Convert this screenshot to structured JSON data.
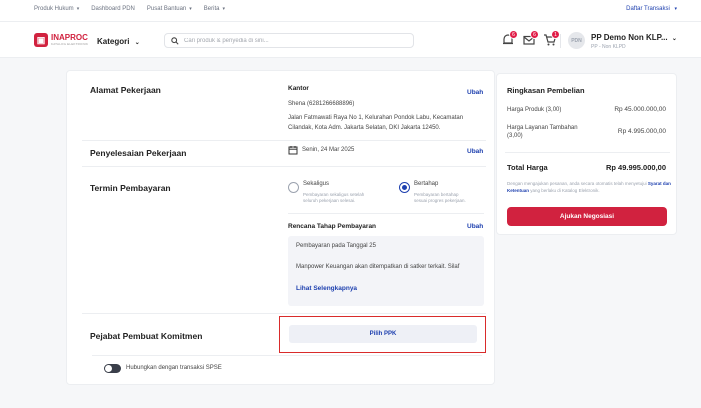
{
  "topnav": {
    "items": [
      "Produk Hukum",
      "Dashboard PDN",
      "Pusat Bantuan",
      "Berita"
    ],
    "daftar_transaksi": "Daftar Transaksi"
  },
  "header": {
    "logo_text": "INAPROC",
    "logo_sub": "KATALOG ELEKTRONIK",
    "kategori": "Kategori",
    "search_placeholder": "Cari produk & penyedia di sini...",
    "badges": [
      "6",
      "6",
      "1"
    ],
    "avatar_text": "PDN",
    "user_name": "PP Demo Non KLP...",
    "user_role": "PP - Non KLPD"
  },
  "alamat": {
    "label": "Alamat Pekerjaan",
    "kantor": "Kantor",
    "ubah": "Ubah",
    "name_phone": "Shena (6281266688896)",
    "address_line1": "Jalan Fatmawati Raya No 1, Kelurahan Pondok Labu, Kecamatan",
    "address_line2": "Cilandak, Kota Adm. Jakarta Selatan, DKI Jakarta 12450."
  },
  "penyelesaian": {
    "label": "Penyelesaian Pekerjaan",
    "date": "Senin, 24 Mar 2025",
    "ubah": "Ubah"
  },
  "termin": {
    "label": "Termin Pembayaran",
    "opt1_title": "Sekaligus",
    "opt1_desc1": "Pembayaran sekaligus setelah",
    "opt1_desc2": "seluruh pekerjaan selesai.",
    "opt2_title": "Bertahap",
    "opt2_desc1": "Pembayaran bertahap",
    "opt2_desc2": "sesuai progres pekerjaan.",
    "selected": "Bertahap",
    "rencana_title": "Rencana Tahap Pembayaran",
    "ubah": "Ubah",
    "plan_line1": "Pembayaran pada Tanggal 25",
    "plan_line2": "Manpower Keuangan akan ditempatkan di satker terkait. Silaf",
    "lihat": "Lihat Selengkapnya"
  },
  "ppk": {
    "label": "Pejabat Pembuat Komitmen",
    "button": "Pilih PPK"
  },
  "toggle": {
    "label": "Hubungkan dengan transaksi SPSE"
  },
  "summary": {
    "title": "Ringkasan Pembelian",
    "harga_produk_label": "Harga Produk (3,00)",
    "harga_produk_value": "Rp 45.000.000,00",
    "layanan_label1": "Harga Layanan Tambahan",
    "layanan_label2": "(3,00)",
    "layanan_value": "Rp 4.995.000,00",
    "total_label": "Total Harga",
    "total_value": "Rp 49.995.000,00",
    "note1": "Dengan mengajukan pesanan, anda secara otomatis telah menyetujui",
    "note_link": "Syarat dan Ketentuan",
    "note2": "yang berlaku di Katalog Elektronik.",
    "button": "Ajukan Negosiasi"
  },
  "colors": {
    "brand_red": "#d1223f",
    "link_blue": "#1e40af",
    "highlight_outline": "#d92b2b"
  }
}
